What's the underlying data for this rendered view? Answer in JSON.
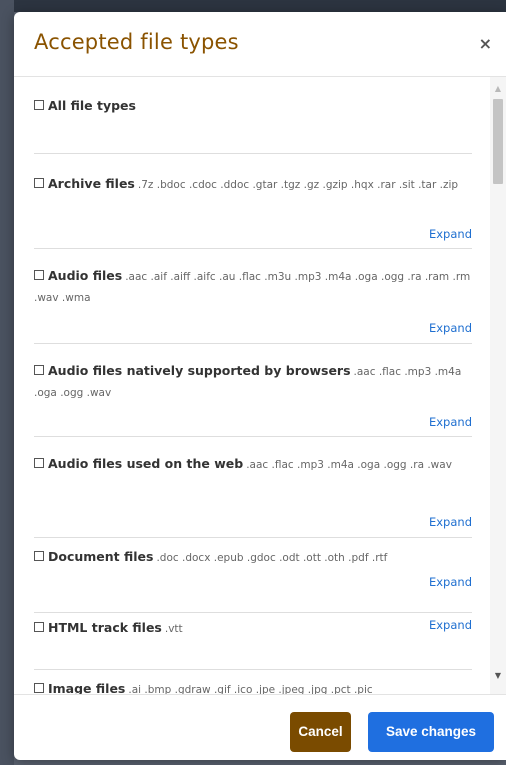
{
  "modal": {
    "title": "Accepted file types",
    "close_symbol": "×",
    "close_icon": "close-icon"
  },
  "colors": {
    "title": "#8a5300",
    "cancel_button": "#7a4b00",
    "save_button": "#1f6fe0",
    "link": "#1f6fd0"
  },
  "file_types": [
    {
      "name": "All file types",
      "exts": "",
      "expand": ""
    },
    {
      "name": "Archive files",
      "exts": ".7z .bdoc .cdoc .ddoc .gtar .tgz .gz .gzip .hqx .rar .sit .tar .zip",
      "expand": "Expand"
    },
    {
      "name": "Audio files",
      "exts": ".aac .aif .aiff .aifc .au .flac .m3u .mp3 .m4a .oga .ogg .ra .ram .rm .wav .wma",
      "expand": "Expand"
    },
    {
      "name": "Audio files natively supported by browsers",
      "exts": ".aac .flac .mp3 .m4a .oga .ogg .wav",
      "expand": "Expand"
    },
    {
      "name": "Audio files used on the web",
      "exts": ".aac .flac .mp3 .m4a .oga .ogg .ra .wav",
      "expand": "Expand"
    },
    {
      "name": "Document files",
      "exts": ".doc .docx .epub .gdoc .odt .ott .oth .pdf .rtf",
      "expand": "Expand"
    },
    {
      "name": "HTML track files",
      "exts": ".vtt",
      "expand": "Expand"
    },
    {
      "name": "Image files",
      "exts": ".ai .bmp .gdraw .gif .ico .jpe .jpeg .jpg .pct .pic",
      "expand": ""
    }
  ],
  "footer": {
    "cancel_label": "Cancel",
    "save_label": "Save changes"
  }
}
